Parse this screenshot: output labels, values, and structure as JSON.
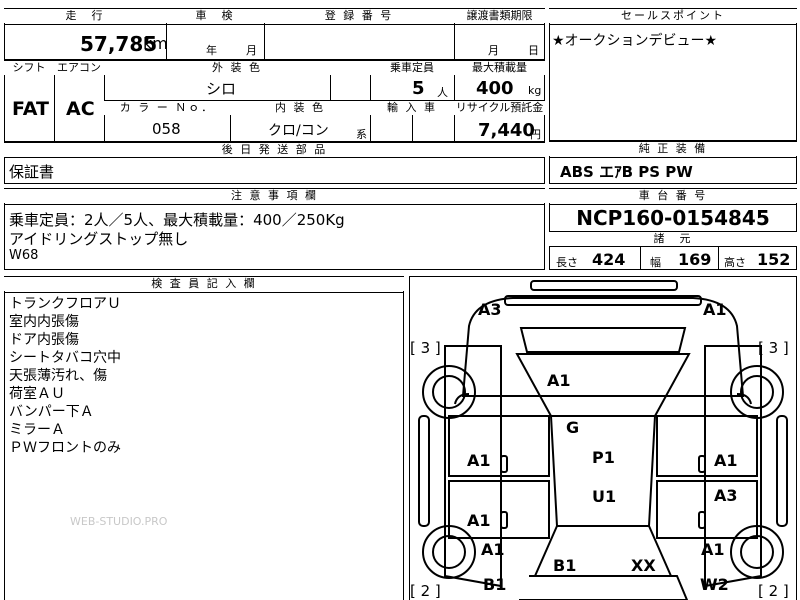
{
  "sheet": {
    "mileage": {
      "label": "走　行",
      "value": "57,785",
      "unit": "km"
    },
    "inspection": {
      "label": "車　検",
      "year_unit": "年",
      "month_unit": "月"
    },
    "registration": {
      "label": "登 録 番 号"
    },
    "transfer": {
      "label": "譲渡書類期限",
      "month_unit": "月",
      "day_unit": "日"
    },
    "shift": {
      "label": "シフト",
      "value": "FAT"
    },
    "aircon": {
      "label": "エアコン",
      "value": "AC"
    },
    "exterior_color": {
      "label": "外 装 色",
      "value": "シロ"
    },
    "capacity": {
      "label": "乗車定員",
      "value": "5",
      "unit": "人"
    },
    "max_load": {
      "label": "最大積載量",
      "value": "400",
      "unit": "kg"
    },
    "color_no": {
      "label": "カ ラ ー Ｎｏ．",
      "value": "058"
    },
    "interior_color": {
      "label": "内 装 色",
      "value": "クロ/コン",
      "suffix": "系"
    },
    "import": {
      "label": "輸 入 車"
    },
    "recycle": {
      "label": "リサイクル預託金",
      "value": "7,440",
      "unit": "円"
    },
    "later_parts": {
      "label": "後 日 発 送 部 品",
      "value": "保証書"
    },
    "sales_point": {
      "label": "セールスポイント",
      "value": "★オークションデビュー★"
    },
    "genuine_equip": {
      "label": "純 正 装 備",
      "value": "ABS エｱB PS PW"
    },
    "cautions": {
      "label": "注 意 事 項 欄",
      "lines": [
        "乗車定員：2人／5人、最大積載量：400／250Kg",
        "アイドリングストップ無し",
        "W68"
      ]
    },
    "chassis": {
      "label": "車 台 番 号",
      "value": "NCP160-0154845"
    },
    "specs": {
      "label": "諸　元",
      "length_label": "長さ",
      "length": "424",
      "width_label": "幅",
      "width": "169",
      "height_label": "高さ",
      "height": "152"
    },
    "inspector": {
      "label": "検 査 員 記 入 欄",
      "lines": [
        "トランクフロアＵ",
        "室内内張傷",
        "ドア内張傷",
        "シートタバコ穴中",
        "天張薄汚れ、傷",
        "荷室ＡＵ",
        "バンパー下Ａ",
        "ミラーＡ",
        "ＰＷフロントのみ"
      ]
    },
    "watermark": "WEB-STUDIO.PRO"
  },
  "diagram": {
    "marks": {
      "a3_top": "A3",
      "a1_top_right": "A1",
      "a1_roof": "A1",
      "g": "G",
      "a1_left_mid": "A1",
      "a1_right_mid": "A1",
      "p1": "P1",
      "u1": "U1",
      "a3_right": "A3",
      "a1_left_low": "A1",
      "a1_left_rear": "A1",
      "a1_right_rear": "A1",
      "b1_center": "B1",
      "xx": "XX",
      "b1_left": "B1",
      "w2": "W2"
    },
    "brackets": {
      "left_upper": "[ 3 ]",
      "right_upper": "[ 3 ]",
      "left_lower": "[ 2 ]",
      "right_lower": "[ 2 ]"
    }
  }
}
